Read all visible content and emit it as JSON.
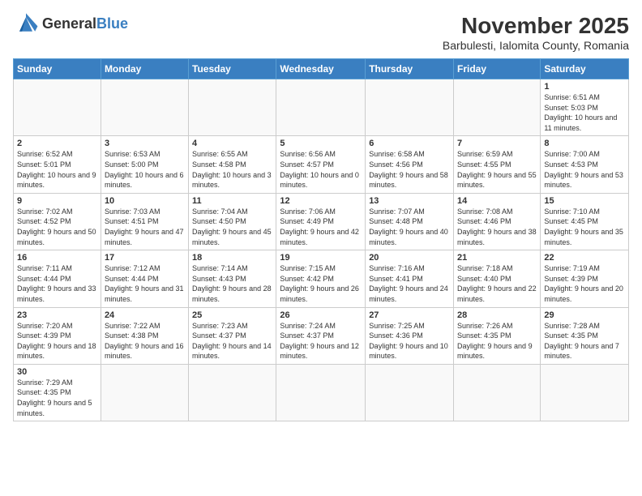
{
  "header": {
    "logo_general": "General",
    "logo_blue": "Blue",
    "month_title": "November 2025",
    "location": "Barbulesti, Ialomita County, Romania"
  },
  "weekdays": [
    "Sunday",
    "Monday",
    "Tuesday",
    "Wednesday",
    "Thursday",
    "Friday",
    "Saturday"
  ],
  "weeks": [
    [
      {
        "day": "",
        "info": ""
      },
      {
        "day": "",
        "info": ""
      },
      {
        "day": "",
        "info": ""
      },
      {
        "day": "",
        "info": ""
      },
      {
        "day": "",
        "info": ""
      },
      {
        "day": "",
        "info": ""
      },
      {
        "day": "1",
        "info": "Sunrise: 6:51 AM\nSunset: 5:03 PM\nDaylight: 10 hours and 11 minutes."
      }
    ],
    [
      {
        "day": "2",
        "info": "Sunrise: 6:52 AM\nSunset: 5:01 PM\nDaylight: 10 hours and 9 minutes."
      },
      {
        "day": "3",
        "info": "Sunrise: 6:53 AM\nSunset: 5:00 PM\nDaylight: 10 hours and 6 minutes."
      },
      {
        "day": "4",
        "info": "Sunrise: 6:55 AM\nSunset: 4:58 PM\nDaylight: 10 hours and 3 minutes."
      },
      {
        "day": "5",
        "info": "Sunrise: 6:56 AM\nSunset: 4:57 PM\nDaylight: 10 hours and 0 minutes."
      },
      {
        "day": "6",
        "info": "Sunrise: 6:58 AM\nSunset: 4:56 PM\nDaylight: 9 hours and 58 minutes."
      },
      {
        "day": "7",
        "info": "Sunrise: 6:59 AM\nSunset: 4:55 PM\nDaylight: 9 hours and 55 minutes."
      },
      {
        "day": "8",
        "info": "Sunrise: 7:00 AM\nSunset: 4:53 PM\nDaylight: 9 hours and 53 minutes."
      }
    ],
    [
      {
        "day": "9",
        "info": "Sunrise: 7:02 AM\nSunset: 4:52 PM\nDaylight: 9 hours and 50 minutes."
      },
      {
        "day": "10",
        "info": "Sunrise: 7:03 AM\nSunset: 4:51 PM\nDaylight: 9 hours and 47 minutes."
      },
      {
        "day": "11",
        "info": "Sunrise: 7:04 AM\nSunset: 4:50 PM\nDaylight: 9 hours and 45 minutes."
      },
      {
        "day": "12",
        "info": "Sunrise: 7:06 AM\nSunset: 4:49 PM\nDaylight: 9 hours and 42 minutes."
      },
      {
        "day": "13",
        "info": "Sunrise: 7:07 AM\nSunset: 4:48 PM\nDaylight: 9 hours and 40 minutes."
      },
      {
        "day": "14",
        "info": "Sunrise: 7:08 AM\nSunset: 4:46 PM\nDaylight: 9 hours and 38 minutes."
      },
      {
        "day": "15",
        "info": "Sunrise: 7:10 AM\nSunset: 4:45 PM\nDaylight: 9 hours and 35 minutes."
      }
    ],
    [
      {
        "day": "16",
        "info": "Sunrise: 7:11 AM\nSunset: 4:44 PM\nDaylight: 9 hours and 33 minutes."
      },
      {
        "day": "17",
        "info": "Sunrise: 7:12 AM\nSunset: 4:44 PM\nDaylight: 9 hours and 31 minutes."
      },
      {
        "day": "18",
        "info": "Sunrise: 7:14 AM\nSunset: 4:43 PM\nDaylight: 9 hours and 28 minutes."
      },
      {
        "day": "19",
        "info": "Sunrise: 7:15 AM\nSunset: 4:42 PM\nDaylight: 9 hours and 26 minutes."
      },
      {
        "day": "20",
        "info": "Sunrise: 7:16 AM\nSunset: 4:41 PM\nDaylight: 9 hours and 24 minutes."
      },
      {
        "day": "21",
        "info": "Sunrise: 7:18 AM\nSunset: 4:40 PM\nDaylight: 9 hours and 22 minutes."
      },
      {
        "day": "22",
        "info": "Sunrise: 7:19 AM\nSunset: 4:39 PM\nDaylight: 9 hours and 20 minutes."
      }
    ],
    [
      {
        "day": "23",
        "info": "Sunrise: 7:20 AM\nSunset: 4:39 PM\nDaylight: 9 hours and 18 minutes."
      },
      {
        "day": "24",
        "info": "Sunrise: 7:22 AM\nSunset: 4:38 PM\nDaylight: 9 hours and 16 minutes."
      },
      {
        "day": "25",
        "info": "Sunrise: 7:23 AM\nSunset: 4:37 PM\nDaylight: 9 hours and 14 minutes."
      },
      {
        "day": "26",
        "info": "Sunrise: 7:24 AM\nSunset: 4:37 PM\nDaylight: 9 hours and 12 minutes."
      },
      {
        "day": "27",
        "info": "Sunrise: 7:25 AM\nSunset: 4:36 PM\nDaylight: 9 hours and 10 minutes."
      },
      {
        "day": "28",
        "info": "Sunrise: 7:26 AM\nSunset: 4:35 PM\nDaylight: 9 hours and 9 minutes."
      },
      {
        "day": "29",
        "info": "Sunrise: 7:28 AM\nSunset: 4:35 PM\nDaylight: 9 hours and 7 minutes."
      }
    ],
    [
      {
        "day": "30",
        "info": "Sunrise: 7:29 AM\nSunset: 4:35 PM\nDaylight: 9 hours and 5 minutes."
      },
      {
        "day": "",
        "info": ""
      },
      {
        "day": "",
        "info": ""
      },
      {
        "day": "",
        "info": ""
      },
      {
        "day": "",
        "info": ""
      },
      {
        "day": "",
        "info": ""
      },
      {
        "day": "",
        "info": ""
      }
    ]
  ]
}
